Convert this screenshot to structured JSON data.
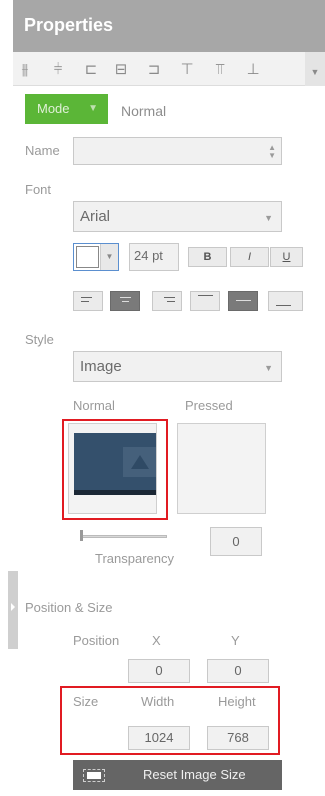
{
  "panel": {
    "title": "Properties"
  },
  "alignbar": {
    "icons": [
      {
        "name": "align-left-edges-icon",
        "glyph": "⫵"
      },
      {
        "name": "align-center-h-icon",
        "glyph": "⫩"
      },
      {
        "name": "align-left-icon",
        "glyph": "⊏"
      },
      {
        "name": "align-center-icon",
        "glyph": "⊟"
      },
      {
        "name": "align-right-icon",
        "glyph": "⊐"
      },
      {
        "name": "align-top-icon",
        "glyph": "⊤"
      },
      {
        "name": "align-middle-icon",
        "glyph": "⫪"
      },
      {
        "name": "align-bottom-icon",
        "glyph": "⊥"
      }
    ],
    "more": "▼"
  },
  "mode": {
    "label": "Mode",
    "caret": "▼",
    "value": "Normal"
  },
  "name": {
    "label": "Name",
    "value": ""
  },
  "font": {
    "label": "Font",
    "family": "Arial",
    "size": "24 pt",
    "bold": "B",
    "italic": "I",
    "underline": "U",
    "align_active": 1,
    "valign_active": 1
  },
  "style": {
    "label": "Style",
    "value": "Image",
    "normal_label": "Normal",
    "pressed_label": "Pressed",
    "highlighted": "normal"
  },
  "transparency": {
    "label": "Transparency",
    "value": "0",
    "level": 0
  },
  "position_size": {
    "section_label": "Position & Size",
    "position_label": "Position",
    "x_label": "X",
    "y_label": "Y",
    "x": "0",
    "y": "0",
    "size_label": "Size",
    "width_label": "Width",
    "height_label": "Height",
    "width": "1024",
    "height": "768"
  },
  "reset": {
    "label": "Reset Image Size"
  },
  "colors": {
    "mode_green": "#5bb637",
    "highlight_red": "#e11b22",
    "image_blue": "#34506c"
  }
}
